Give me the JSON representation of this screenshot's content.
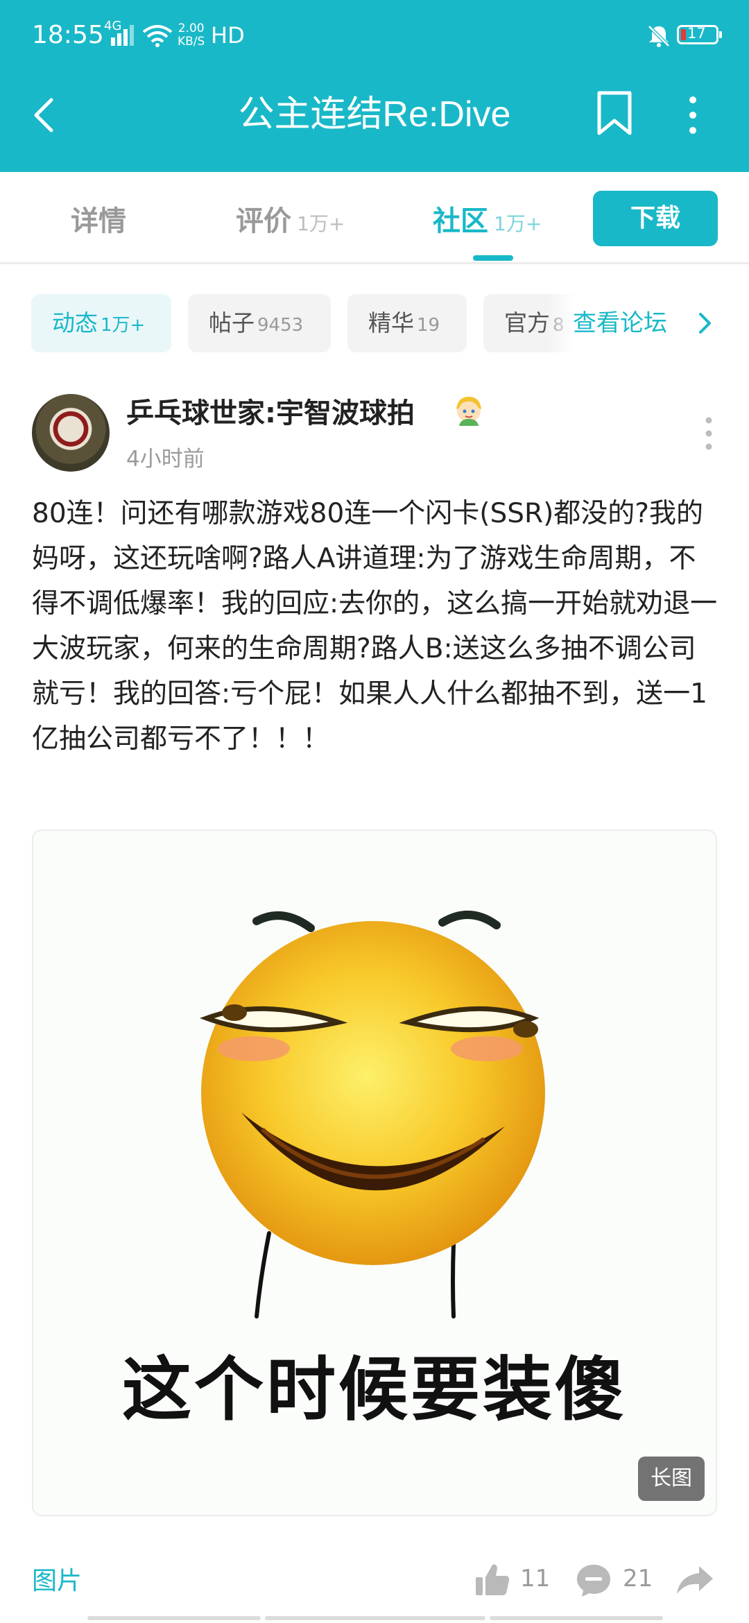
{
  "status_bar": {
    "time": "18:55",
    "network": "4G",
    "speed_value": "2.00",
    "speed_unit": "KB/S",
    "hd": "HD",
    "battery": "17",
    "icons": [
      "signal-icon",
      "wifi-icon",
      "bell-muted-icon",
      "battery-icon"
    ]
  },
  "app_bar": {
    "title": "公主连结Re:Dive",
    "icons": [
      "back-arrow-icon",
      "bookmark-icon",
      "more-vertical-icon"
    ]
  },
  "tabs": [
    {
      "label": "详情",
      "count": "",
      "active": false
    },
    {
      "label": "评价",
      "count": "1万+",
      "active": false
    },
    {
      "label": "社区",
      "count": "1万+",
      "active": true
    }
  ],
  "download_label": "下载",
  "filters": [
    {
      "label": "动态",
      "count": "1万+",
      "active": true
    },
    {
      "label": "帖子",
      "count": "9453",
      "active": false
    },
    {
      "label": "精华",
      "count": "19",
      "active": false
    },
    {
      "label": "官方",
      "count": "8",
      "active": false
    }
  ],
  "forum_link": "查看论坛",
  "post": {
    "author": "乒乓球世家:宇智波球拍",
    "time": "4小时前",
    "content": "80连！问还有哪款游戏80连一个闪卡(SSR)都没的?我的妈呀，这还玩啥啊?路人A讲道理:为了游戏生命周期，不得不调低爆率！我的回应:去你的，这么搞一开始就劝退一大波玩家，何来的生命周期?路人B:送这么多抽不调公司就亏！我的回答:亏个屁！如果人人什么都抽不到，送一1亿抽公司都亏不了！！！",
    "image_caption": "这个时候要装傻",
    "image_badge": "长图",
    "tag": "图片",
    "likes": "11",
    "comments": "21"
  },
  "colors": {
    "accent": "#19b8c8",
    "text": "#222222",
    "muted": "#9a9a9a",
    "emoji_yellow": "#f5b21c"
  }
}
